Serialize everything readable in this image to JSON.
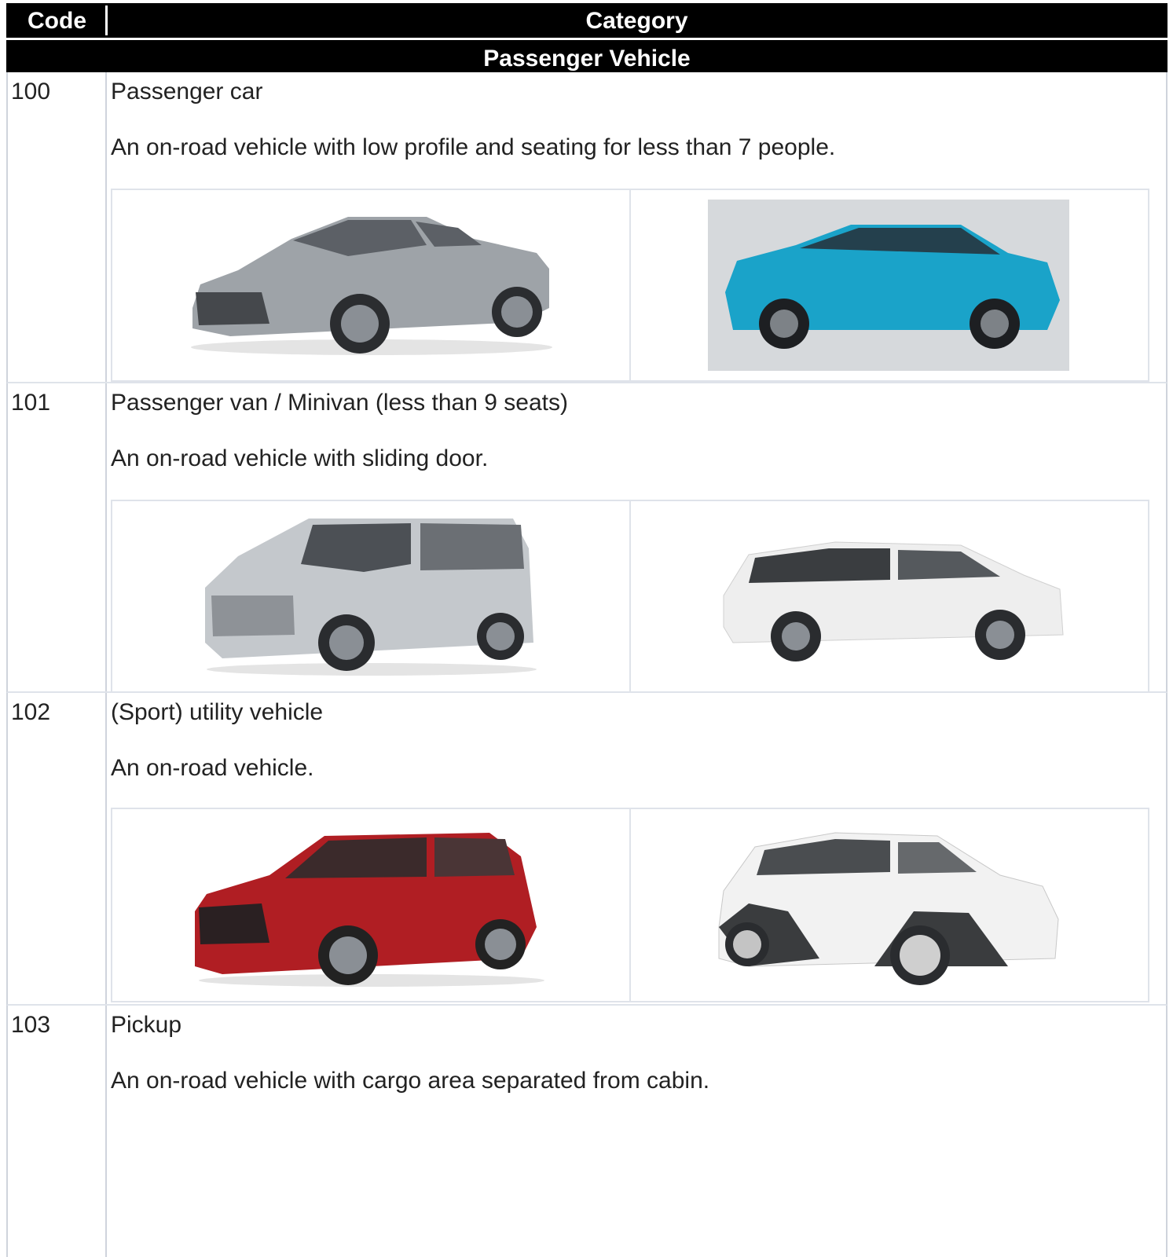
{
  "header": {
    "code_label": "Code",
    "category_label": "Category"
  },
  "section": {
    "title": "Passenger Vehicle"
  },
  "rows": [
    {
      "code": "100",
      "name": "Passenger car",
      "description": "An on-road vehicle with low profile and seating for less than 7 people.",
      "images": [
        {
          "kind": "sedan-photo",
          "color": "#9ea3a8"
        },
        {
          "kind": "coupe-photo",
          "color": "#1aa3c9"
        }
      ]
    },
    {
      "code": "101",
      "name": "Passenger van / Minivan (less than 9 seats)",
      "description": "An on-road vehicle with sliding door.",
      "images": [
        {
          "kind": "van-photo",
          "color": "#c4c8cc"
        },
        {
          "kind": "minivan-photo",
          "color": "#eeeeee"
        }
      ]
    },
    {
      "code": "102",
      "name": "(Sport) utility vehicle",
      "description": "An on-road vehicle.",
      "images": [
        {
          "kind": "suv-photo",
          "color": "#b01e23"
        },
        {
          "kind": "crossover-photo",
          "color": "#f2f2f2"
        }
      ]
    },
    {
      "code": "103",
      "name": "Pickup",
      "description": "An on-road vehicle with cargo area separated from cabin."
    }
  ]
}
